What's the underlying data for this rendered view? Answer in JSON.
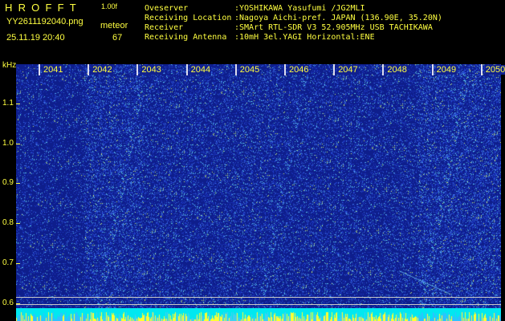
{
  "header": {
    "app_name": "HROFFT",
    "version": "1.00f",
    "filename": "YY2611192040.png",
    "datetime": "25.11.19 20:40",
    "meteor_label": "meteor",
    "meteor_count": "67"
  },
  "station": [
    {
      "key": "Oveserver",
      "value": ":YOSHIKAWA Yasufumi /JG2MLI"
    },
    {
      "key": "Receiving Location",
      "value": ":Nagoya Aichi-pref. JAPAN (136.90E, 35.20N)"
    },
    {
      "key": "Receiver",
      "value": ":SMArt RTL-SDR V3 52.905MHz USB TACHIKAWA"
    },
    {
      "key": "Receiving Antenna",
      "value": ":10mH 3el.YAGI Horizontal:ENE"
    }
  ],
  "spectrogram": {
    "y_unit": "kHz",
    "y_ticks": [
      "1.1",
      "1.0",
      "0.9",
      "0.8",
      "0.7",
      "0.6"
    ],
    "time_labels": [
      "2041",
      "2042",
      "2043",
      "2044",
      "2045",
      "2046",
      "2047",
      "2048",
      "2049",
      "2050"
    ],
    "colors": {
      "background": "#10208f",
      "label": "#ffff40",
      "signal": "#00ffff"
    }
  }
}
